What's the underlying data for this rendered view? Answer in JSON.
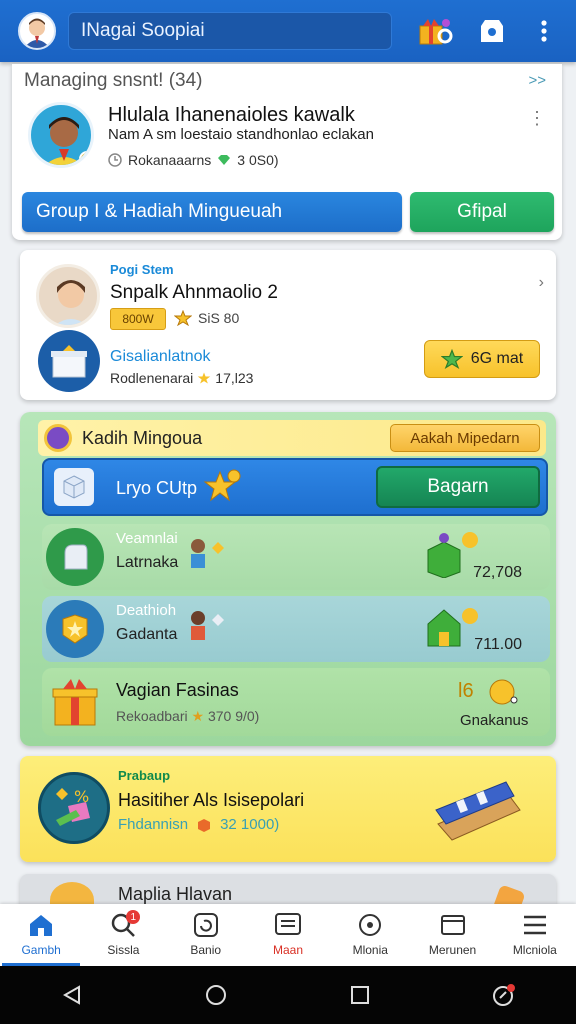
{
  "topbar": {
    "search_placeholder": "INagai Soopiai",
    "icons": [
      "avatar",
      "gift-icon",
      "shop-icon",
      "more-vert-icon"
    ]
  },
  "card1": {
    "header": "Managing snsnt! (34)",
    "header_icon": ">>",
    "title": "Hlulala Ihanenaioles kawalk",
    "subtitle": "Nam A sm loestaio standhonlao eclakan",
    "meta": "Rokanaaarns",
    "meta_value": "3  0S0)",
    "more": "⋮",
    "btn_primary": "Group I & Hadiah Mingueuah",
    "btn_secondary": "Gfipal"
  },
  "card2": {
    "label": "Pogi Stem",
    "title": "Snpalk Ahnmaolio 2",
    "badge": "800W",
    "coins": "SiS 80",
    "sub_title": "Gisalianlatnok",
    "sub_meta": "Rodlenenarai",
    "sub_value": "17,l23",
    "action": "6G mat",
    "chevron": "›"
  },
  "rewards": {
    "header_title": "Kadih Mingoua",
    "header_button": "Aakah Mipedarn",
    "blue_label": "Lryo CUtp",
    "blue_button": "Bagarn",
    "rows": [
      {
        "t1": "Veamnlai",
        "t2": "Latrnaka",
        "value": "72,708",
        "color": "#2f9a4a"
      },
      {
        "t1": "Deathioh",
        "t2": "Gadanta",
        "value": "711.00",
        "color": "#2b7bb9"
      }
    ],
    "row3": {
      "t1": "Vagian Fasinas",
      "t2": "Rekoadbari",
      "t2_value": "370 9/0)",
      "right_num": "l6",
      "right_label": "Gnakanus"
    }
  },
  "card4": {
    "label": "Prabaup",
    "title": "Hasitiher Als Isisepolari",
    "meta": "Fhdannisn",
    "meta_value": "32  1000)"
  },
  "card5": {
    "title": "Maplia Hlavan"
  },
  "tabs": [
    {
      "label": "Gambh",
      "icon": "home-icon",
      "active": true
    },
    {
      "label": "Sissla",
      "icon": "search-icon",
      "badge": "1"
    },
    {
      "label": "Banio",
      "icon": "refresh-icon"
    },
    {
      "label": "Maan",
      "icon": "chat-icon",
      "red": true
    },
    {
      "label": "Mlonia",
      "icon": "target-icon"
    },
    {
      "label": "Merunen",
      "icon": "folder-icon"
    },
    {
      "label": "Mlcniola",
      "icon": "menu-icon"
    }
  ],
  "colors": {
    "primary": "#1f6fd1",
    "green": "#1ea45c",
    "yellow": "#f7c22b"
  }
}
